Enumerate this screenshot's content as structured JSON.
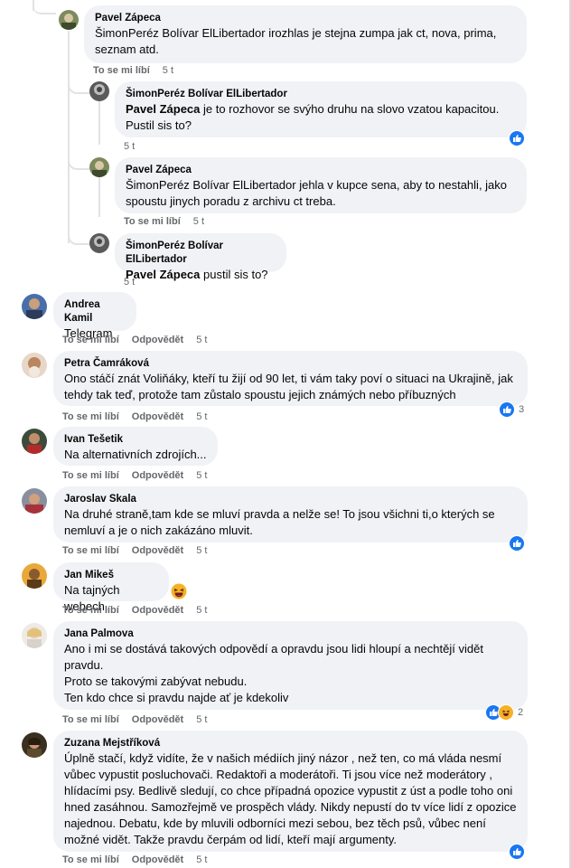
{
  "labels": {
    "like": "To se mi líbí",
    "reply": "Odpovědět"
  },
  "comments": [
    {
      "name": "Pavel Zápeca",
      "mention": "",
      "text": "ŠimonPeréz Bolívar ElLibertador irozhlas je stejna zumpa jak ct, nova, prima, seznam atd.",
      "time": "5 t"
    },
    {
      "name": "ŠimonPeréz Bolívar ElLibertador",
      "mention": "Pavel Zápeca",
      "text": " je to rozhovor se svýho druhu na slovo vzatou kapacitou. Pustil sis to?",
      "time": "5 t"
    },
    {
      "name": "Pavel Zápeca",
      "mention": "",
      "text": "ŠimonPeréz Bolívar ElLibertador jehla v kupce sena, aby to nestahli, jako spoustu jinych poradu z archivu ct treba.",
      "time": "5 t"
    },
    {
      "name": "ŠimonPeréz Bolívar ElLibertador",
      "mention": "Pavel Zápeca",
      "text": " pustil sis to?",
      "time": "5 t"
    },
    {
      "name": "Andrea Kamil",
      "mention": "",
      "text": "Telegram",
      "time": "5 t"
    },
    {
      "name": "Petra Čamráková",
      "mention": "",
      "text": "Ono stáčí znát Voliňáky, kteří tu žijí od 90 let, ti vám taky poví o situaci na Ukrajině, jak tehdy tak teď, protože tam zůstalo spoustu jejich známých nebo příbuzných",
      "time": "5 t",
      "reaction_count": "3"
    },
    {
      "name": "Ivan Tešetik",
      "mention": "",
      "text": "Na alternativních zdrojích...",
      "time": "5 t"
    },
    {
      "name": "Jaroslav Skala",
      "mention": "",
      "text": "Na druhé straně,tam kde se mluví pravda a nelže se! To jsou všichni ti,o kterých se nemluví a je o nich zakázáno mluvit.",
      "time": "5 t"
    },
    {
      "name": "Jan Mikeš",
      "mention": "",
      "text": "Na tajných webech.",
      "time": "5 t"
    },
    {
      "name": "Jana Palmova",
      "mention": "",
      "text": "Ano i mi se dostává takových odpovědí a opravdu jsou lidi hloupí a nechtějí vidět pravdu.",
      "text2": "Proto se takovými zabývat nebudu.",
      "text3": "Ten kdo chce si pravdu najde ať je kdekoliv",
      "time": "5 t",
      "reaction_count": "2"
    },
    {
      "name": "Zuzana Mejstříková",
      "mention": "",
      "text": "Úplně stačí, když vidíte, že v našich médiích jiný názor , než ten, co má vláda nesmí vůbec vypustit posluchovači. Redaktoři a moderátoři. Ti jsou více než moderátory , hlídacími psy. Bedlivě sledují, co chce případná opozice vypustit z úst a podle toho oni hned zasáhnou. Samozřejmě ve prospěch vlády. Nikdy nepustí do tv více lidí z opozice najednou. Debatu, kde by mluvili odborníci mezi sebou, bez těch psů, vůbec není možné vidět. Takže pravdu čerpám od lidí, kteří mají argumenty.",
      "time": "5 t"
    }
  ]
}
